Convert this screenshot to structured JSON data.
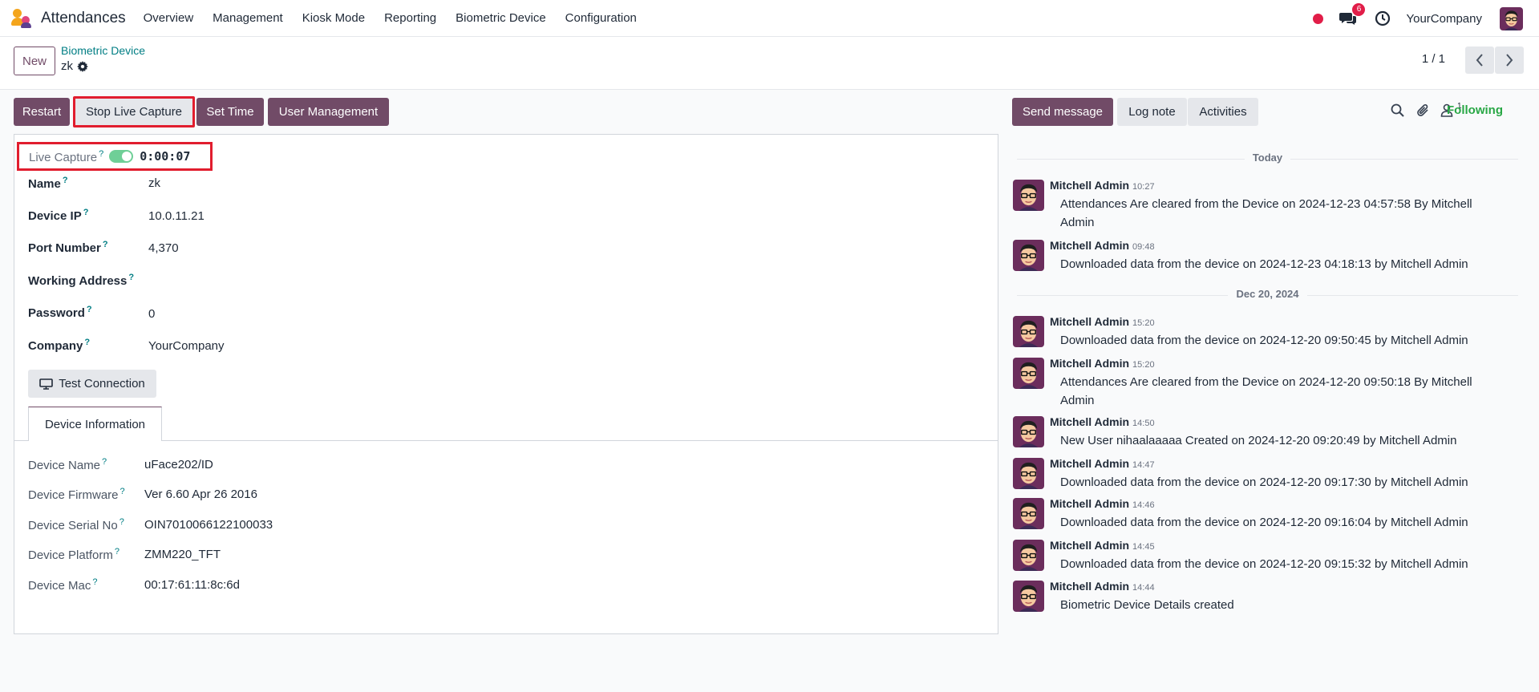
{
  "navbar": {
    "app_name": "Attendances",
    "menu": [
      "Overview",
      "Management",
      "Kiosk Mode",
      "Reporting",
      "Biometric Device",
      "Configuration"
    ],
    "message_count": "6",
    "company": "YourCompany"
  },
  "control": {
    "new_label": "New",
    "breadcrumb": "Biometric Device",
    "record_name": "zk",
    "pager": "1 / 1"
  },
  "actions": {
    "restart": "Restart",
    "stop_live_capture": "Stop Live Capture",
    "set_time": "Set Time",
    "user_management": "User Management"
  },
  "form": {
    "live_capture_label": "Live Capture",
    "live_capture_on": true,
    "live_timer": "0:00:07",
    "fields": [
      {
        "label": "Name",
        "value": "zk"
      },
      {
        "label": "Device IP",
        "value": "10.0.11.21"
      },
      {
        "label": "Port Number",
        "value": "4,370"
      },
      {
        "label": "Working Address",
        "value": ""
      },
      {
        "label": "Password",
        "value": "0"
      },
      {
        "label": "Company",
        "value": "YourCompany"
      }
    ],
    "test_connection": "Test Connection",
    "tab_label": "Device Information",
    "device_info": [
      {
        "label": "Device Name",
        "value": "uFace202/ID"
      },
      {
        "label": "Device Firmware",
        "value": "Ver 6.60 Apr 26 2016"
      },
      {
        "label": "Device Serial No",
        "value": "OIN7010066122100033"
      },
      {
        "label": "Device Platform",
        "value": "ZMM220_TFT"
      },
      {
        "label": "Device Mac",
        "value": "00:17:61:11:8c:6d"
      }
    ],
    "help_mark": "?"
  },
  "chatter": {
    "send_message": "Send message",
    "log_note": "Log note",
    "activities": "Activities",
    "follower_count": "1",
    "following": "Following",
    "date_today": "Today",
    "date_earlier": "Dec 20, 2024",
    "messages": [
      {
        "author": "Mitchell Admin",
        "time": "10:27",
        "body": "Attendances Are cleared from the Device on 2024-12-23 04:57:58 By Mitchell Admin"
      },
      {
        "author": "Mitchell Admin",
        "time": "09:48",
        "body": "Downloaded data from the device on 2024-12-23 04:18:13 by Mitchell Admin"
      },
      {
        "author": "Mitchell Admin",
        "time": "15:20",
        "body": "Downloaded data from the device on 2024-12-20 09:50:45 by Mitchell Admin"
      },
      {
        "author": "Mitchell Admin",
        "time": "15:20",
        "body": "Attendances Are cleared from the Device on 2024-12-20 09:50:18 By Mitchell Admin"
      },
      {
        "author": "Mitchell Admin",
        "time": "14:50",
        "body": "New User nihaalaaaaa Created on 2024-12-20 09:20:49 by Mitchell Admin"
      },
      {
        "author": "Mitchell Admin",
        "time": "14:47",
        "body": "Downloaded data from the device on 2024-12-20 09:17:30 by Mitchell Admin"
      },
      {
        "author": "Mitchell Admin",
        "time": "14:46",
        "body": "Downloaded data from the device on 2024-12-20 09:16:04 by Mitchell Admin"
      },
      {
        "author": "Mitchell Admin",
        "time": "14:45",
        "body": "Downloaded data from the device on 2024-12-20 09:15:32 by Mitchell Admin"
      },
      {
        "author": "Mitchell Admin",
        "time": "14:44",
        "body": "Biometric Device Details created"
      }
    ]
  },
  "colors": {
    "brand": "#714b67",
    "highlight": "#e11d2e",
    "following": "#28a745",
    "link": "#017e84"
  }
}
